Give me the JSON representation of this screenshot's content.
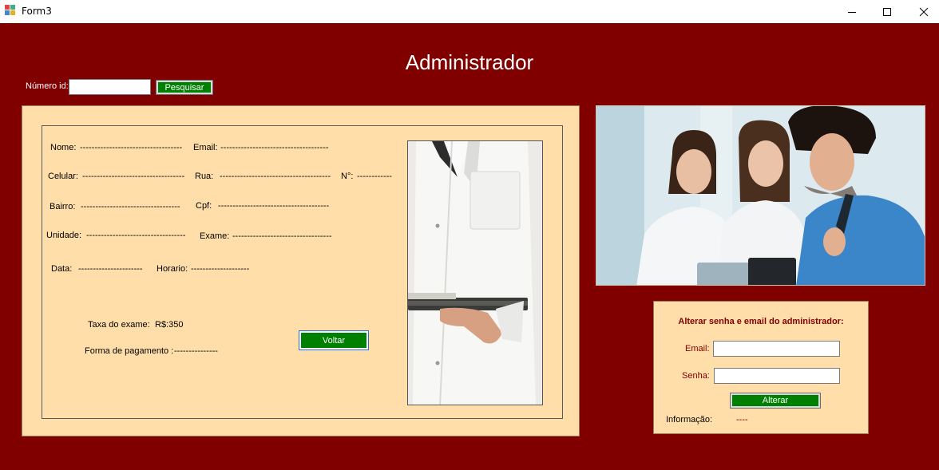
{
  "window": {
    "title": "Form3"
  },
  "header": {
    "title": "Administrador"
  },
  "search": {
    "id_label": "Número id:",
    "id_value": "",
    "button_label": "Pesquisar"
  },
  "details": {
    "nome_label": "Nome:",
    "nome_value": "-----------------------------------",
    "email_label": "Email:",
    "email_value": "-------------------------------------",
    "celular_label": "Celular:",
    "celular_value": "-----------------------------------",
    "rua_label": "Rua:",
    "rua_value": "--------------------------------------",
    "numero_label": "N°:",
    "numero_value": "------------",
    "bairro_label": "Bairro:",
    "bairro_value": "----------------------------------",
    "cpf_label": "Cpf:",
    "cpf_value": "--------------------------------------",
    "unidade_label": "Unidade:",
    "unidade_value": "----------------------------------",
    "exame_label": "Exame:",
    "exame_value": "----------------------------------",
    "data_label": "Data:",
    "data_value": "----------------------",
    "horario_label": "Horario:",
    "horario_value": "--------------------",
    "taxa_label": "Taxa do exame:",
    "taxa_value": "R$:350",
    "pagamento_label": "Forma de pagamento :",
    "pagamento_value": "---------------",
    "voltar_label": "Voltar"
  },
  "images": {
    "doctor": "doctor-with-clipboard-photo",
    "team": "medical-team-photo"
  },
  "change_credentials": {
    "title": "Alterar senha e email do administrador:",
    "email_label": "Email:",
    "email_value": "",
    "senha_label": "Senha:",
    "senha_value": "",
    "button_label": "Alterar",
    "info_label": "Informação:",
    "info_value": "----"
  },
  "colors": {
    "background": "#800000",
    "panel": "#ffdeaa",
    "button": "#008000",
    "accent_text": "#800000"
  }
}
